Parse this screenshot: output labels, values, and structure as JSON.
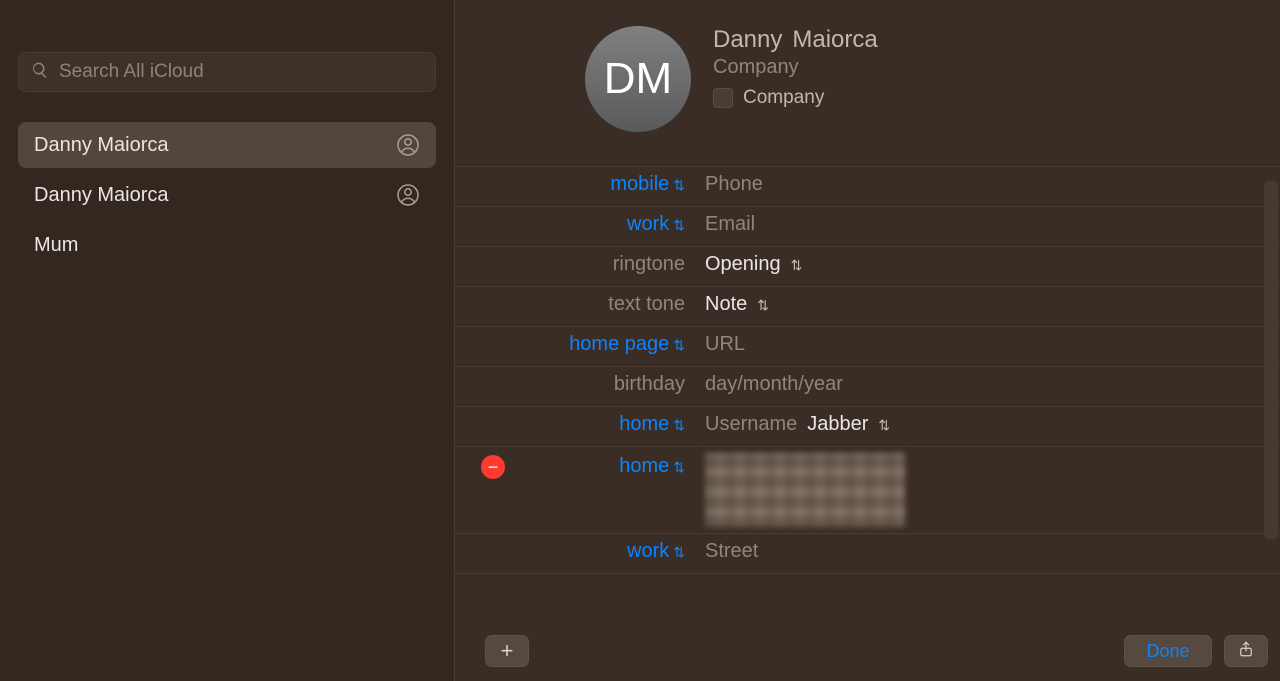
{
  "sidebar": {
    "search_placeholder": "Search All iCloud",
    "items": [
      {
        "label": "Danny  Maiorca",
        "has_icon": true,
        "selected": true
      },
      {
        "label": "Danny Maiorca",
        "has_icon": true,
        "selected": false
      },
      {
        "label": "Mum",
        "has_icon": false,
        "selected": false
      }
    ]
  },
  "card": {
    "avatar_initials": "DM",
    "first_name": "Danny",
    "last_name": "Maiorca",
    "company_placeholder": "Company",
    "company_checkbox_label": "Company"
  },
  "fields": {
    "phone_label": "mobile",
    "phone_placeholder": "Phone",
    "email_label": "work",
    "email_placeholder": "Email",
    "ringtone_label": "ringtone",
    "ringtone_value": "Opening",
    "texttone_label": "text tone",
    "texttone_value": "Note",
    "homepage_label": "home page",
    "homepage_placeholder": "URL",
    "birthday_label": "birthday",
    "birthday_placeholder": "day/month/year",
    "im_label": "home",
    "im_username_placeholder": "Username",
    "im_service": "Jabber",
    "address_home_label": "home",
    "address_work_label": "work",
    "address_work_placeholder": "Street"
  },
  "footer": {
    "done_label": "Done"
  }
}
